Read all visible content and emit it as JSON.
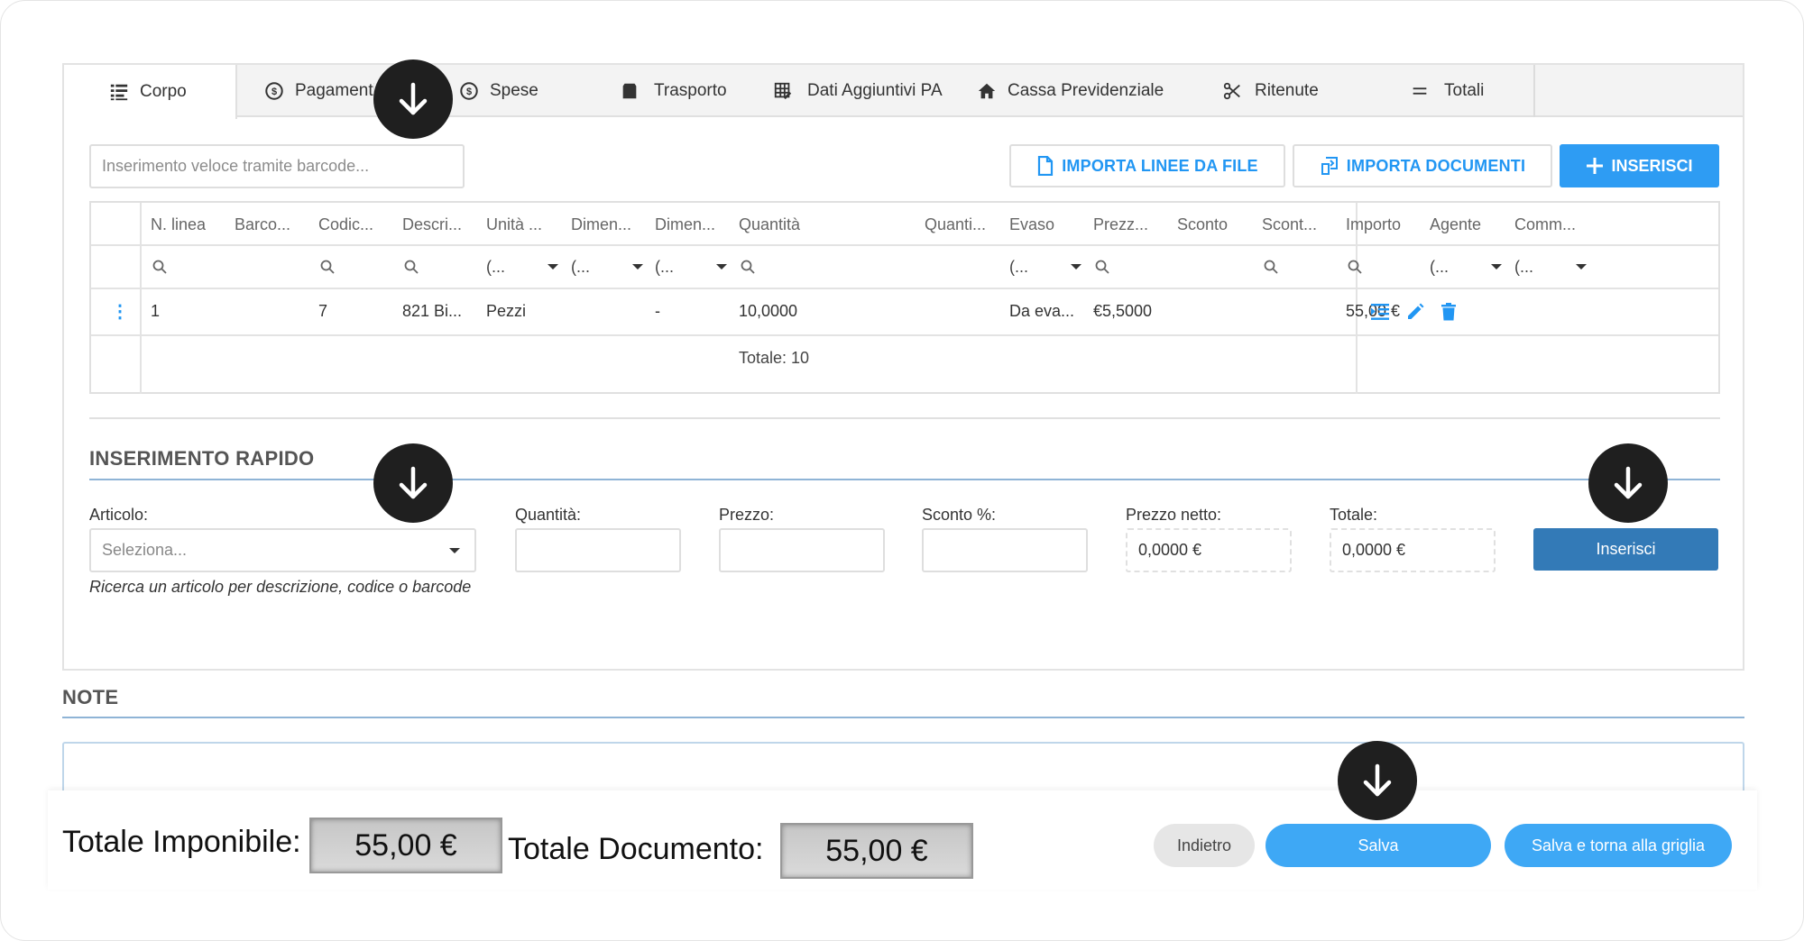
{
  "tabs": [
    {
      "label": "Corpo",
      "icon": "list-icon"
    },
    {
      "label": "Pagamenti",
      "icon": "dollar-circle-icon"
    },
    {
      "label": "Spese",
      "icon": "dollar-circle-icon"
    },
    {
      "label": "Trasporto",
      "icon": "box-icon"
    },
    {
      "label": "Dati Aggiuntivi PA",
      "icon": "table-edit-icon"
    },
    {
      "label": "Cassa Previdenziale",
      "icon": "home-icon"
    },
    {
      "label": "Ritenute",
      "icon": "scissors-icon"
    },
    {
      "label": "Totali",
      "icon": "equals-icon"
    }
  ],
  "toolbar": {
    "barcode_placeholder": "Inserimento veloce tramite barcode...",
    "import_file_label": "IMPORTA LINEE DA FILE",
    "import_docs_label": "IMPORTA DOCUMENTI",
    "insert_label": "INSERISCI"
  },
  "grid": {
    "columns": [
      "N. linea",
      "Barco...",
      "Codic...",
      "Descri...",
      "Unità ...",
      "Dimen...",
      "Dimen...",
      "Quantità",
      "Quanti...",
      "Evaso",
      "Prezz...",
      "Sconto",
      "Scont...",
      "Importo",
      "Agente",
      "Comm..."
    ],
    "filter_dropdown_text": "(...",
    "rows": [
      {
        "n_linea": "1",
        "codice": "7",
        "descrizione": "821 Bi...",
        "unita": "Pezzi",
        "dimensione": "-",
        "quantita": "10,0000",
        "evaso": "Da eva...",
        "prezzo": "€5,5000",
        "importo": "55,00 €"
      }
    ],
    "summary": "Totale: 10"
  },
  "rapid": {
    "title": "INSERIMENTO RAPIDO",
    "articolo_label": "Articolo:",
    "articolo_placeholder": "Seleziona...",
    "articolo_hint": "Ricerca un articolo per descrizione, codice o barcode",
    "quantita_label": "Quantità:",
    "prezzo_label": "Prezzo:",
    "sconto_label": "Sconto %:",
    "prezzo_netto_label": "Prezzo netto:",
    "prezzo_netto_value": "0,0000 €",
    "totale_label": "Totale:",
    "totale_value": "0,0000 €",
    "insert_label": "Inserisci"
  },
  "note": {
    "title": "NOTE"
  },
  "footer": {
    "imponibile_label": "Totale Imponibile:",
    "imponibile_value": "55,00 €",
    "documento_label": "Totale Documento:",
    "documento_value": "55,00 €",
    "back_label": "Indietro",
    "save_label": "Salva",
    "save_back_label": "Salva e torna alla griglia"
  },
  "colors": {
    "accent": "#2196f3",
    "insert_button": "#337ab7",
    "arrow_marker": "#1f1f1f"
  }
}
